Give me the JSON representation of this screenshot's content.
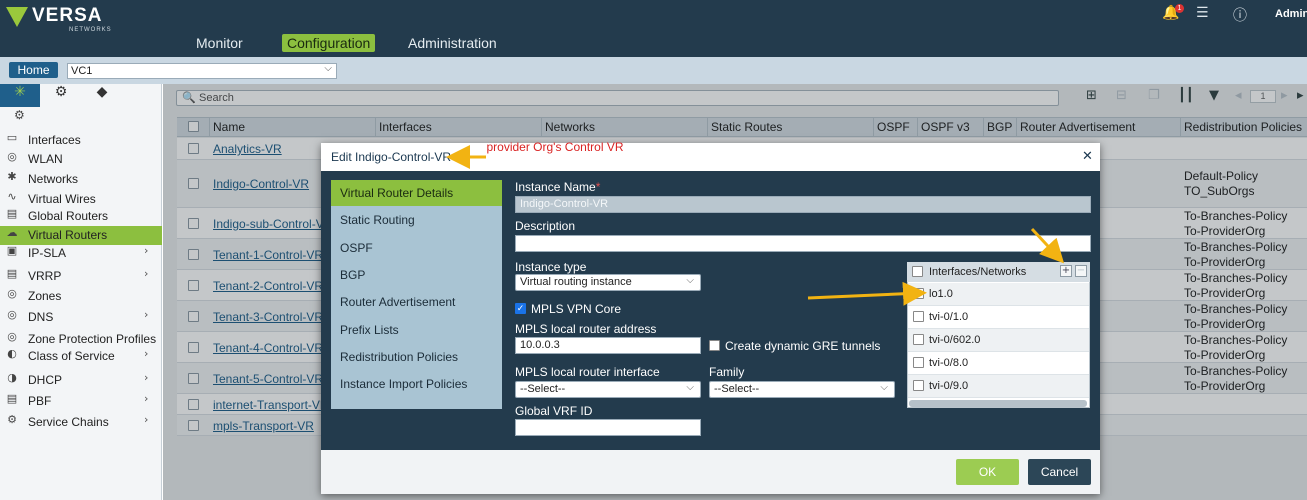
{
  "brand": {
    "name": "VERSA",
    "sub": "NETWORKS"
  },
  "topnav": {
    "monitor": "Monitor",
    "configuration": "Configuration",
    "administration": "Administration"
  },
  "topright": {
    "notifications_count": "1",
    "user": "Admini"
  },
  "context": {
    "home_label": "Home",
    "vc_value": "VC1"
  },
  "sidebar": {
    "items": [
      {
        "label": "Interfaces",
        "icon": "interfaces-icon"
      },
      {
        "label": "WLAN",
        "icon": "wlan-icon"
      },
      {
        "label": "Networks",
        "icon": "networks-icon"
      },
      {
        "label": "Virtual Wires",
        "icon": "virtual-wires-icon"
      },
      {
        "label": "Global Routers",
        "icon": "global-routers-icon"
      },
      {
        "label": "Virtual Routers",
        "icon": "virtual-routers-icon",
        "selected": true
      },
      {
        "label": "IP-SLA",
        "icon": "ip-sla-icon",
        "expandable": true
      },
      {
        "label": "VRRP",
        "icon": "vrrp-icon",
        "expandable": true
      },
      {
        "label": "Zones",
        "icon": "zones-icon"
      },
      {
        "label": "DNS",
        "icon": "dns-icon",
        "expandable": true
      },
      {
        "label": "Zone Protection Profiles",
        "icon": "zone-protection-icon"
      },
      {
        "label": "Class of Service",
        "icon": "class-of-service-icon",
        "expandable": true
      },
      {
        "label": "DHCP",
        "icon": "dhcp-icon",
        "expandable": true
      },
      {
        "label": "PBF",
        "icon": "pbf-icon",
        "expandable": true
      },
      {
        "label": "Service Chains",
        "icon": "service-chains-icon",
        "expandable": true
      }
    ]
  },
  "grid": {
    "search_placeholder": "Search",
    "pager_value": "1",
    "columns": [
      "Name",
      "Interfaces",
      "Networks",
      "Static Routes",
      "OSPF",
      "OSPF v3",
      "BGP",
      "Router Advertisement",
      "Redistribution Policies"
    ],
    "rows": [
      {
        "name": "Analytics-VR",
        "policies": []
      },
      {
        "name": "Indigo-Control-VR",
        "policies": [
          "Default-Policy",
          "TO_SubOrgs"
        ]
      },
      {
        "name": "Indigo-sub-Control-VR",
        "policies": [
          "To-Branches-Policy",
          "To-ProviderOrg"
        ]
      },
      {
        "name": "Tenant-1-Control-VR",
        "policies": [
          "To-Branches-Policy",
          "To-ProviderOrg"
        ]
      },
      {
        "name": "Tenant-2-Control-VR",
        "policies": [
          "To-Branches-Policy",
          "To-ProviderOrg"
        ]
      },
      {
        "name": "Tenant-3-Control-VR",
        "policies": [
          "To-Branches-Policy",
          "To-ProviderOrg"
        ]
      },
      {
        "name": "Tenant-4-Control-VR",
        "policies": [
          "To-Branches-Policy",
          "To-ProviderOrg"
        ]
      },
      {
        "name": "Tenant-5-Control-VR",
        "policies": [
          "To-Branches-Policy",
          "To-ProviderOrg"
        ]
      },
      {
        "name": "internet-Transport-VR",
        "policies": []
      },
      {
        "name": "mpls-Transport-VR",
        "policies": []
      }
    ]
  },
  "modal": {
    "title": "Edit Indigo-Control-VR",
    "nav": [
      "Virtual Router Details",
      "Static Routing",
      "OSPF",
      "BGP",
      "Router Advertisement",
      "Prefix Lists",
      "Redistribution Policies",
      "Instance Import Policies"
    ],
    "fields": {
      "instance_name_label": "Instance Name",
      "instance_name_value": "Indigo-Control-VR",
      "description_label": "Description",
      "description_value": "",
      "instance_type_label": "Instance type",
      "instance_type_value": "Virtual routing instance",
      "mpls_vpn_core_label": "MPLS VPN Core",
      "mpls_local_addr_label": "MPLS local router address",
      "mpls_local_addr_value": "10.0.0.3",
      "gre_label": "Create dynamic GRE tunnels",
      "mpls_local_iface_label": "MPLS local router interface",
      "mpls_local_iface_value": "--Select--",
      "family_label": "Family",
      "family_value": "--Select--",
      "global_vrf_label": "Global VRF ID",
      "global_vrf_value": ""
    },
    "interfaces": {
      "header": "Interfaces/Networks",
      "items": [
        "lo1.0",
        "tvi-0/1.0",
        "tvi-0/602.0",
        "tvi-0/8.0",
        "tvi-0/9.0"
      ]
    },
    "ok_label": "OK",
    "cancel_label": "Cancel"
  },
  "annotation": {
    "text": "provider Org's Control VR",
    "color": "#d92323",
    "arrow_color": "#f2b312"
  },
  "colors": {
    "accent": "#8cbf3f",
    "header": "#233b4d",
    "link": "#1f5f8b"
  }
}
